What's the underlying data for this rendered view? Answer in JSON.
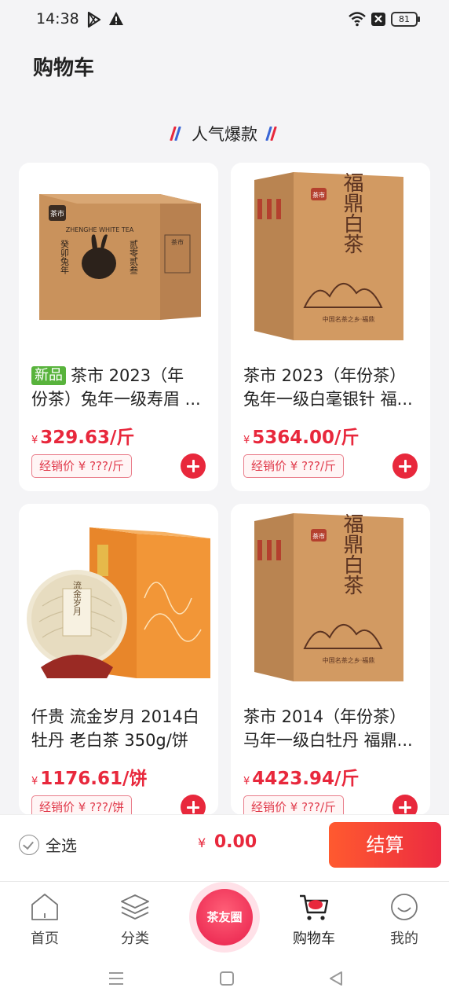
{
  "status_bar": {
    "time": "14:38",
    "battery": "81",
    "icons": [
      "play-store-icon",
      "warning-icon",
      "wifi-icon",
      "sim-card-off-icon",
      "battery-icon"
    ]
  },
  "page": {
    "title": "购物车"
  },
  "section": {
    "title": "人气爆款",
    "icon": "decorative-stripe-icon"
  },
  "products": [
    {
      "badge": "新品",
      "name_line1": "茶市 2023（年",
      "name_line2": "份茶）兔年一级寿眉 ...",
      "price_currency": "¥",
      "price": "329.63/斤",
      "dealer_price": "经销价 ¥ ???/斤",
      "image": "rabbit-year-tea-box-image"
    },
    {
      "badge": "",
      "name_line1": "茶市 2023（年份茶）",
      "name_line2": "兔年一级白毫银针 福...",
      "price_currency": "¥",
      "price": "5364.00/斤",
      "dealer_price": "经销价 ¥ ???/斤",
      "image": "fuding-white-tea-box-image"
    },
    {
      "badge": "",
      "name_line1": "仟贵 流金岁月 2014白",
      "name_line2": "牡丹 老白茶 350g/饼",
      "price_currency": "¥",
      "price": "1176.61/饼",
      "dealer_price": "经销价 ¥ ???/饼",
      "image": "tea-cake-gift-box-image",
      "box_text": "流金岁月"
    },
    {
      "badge": "",
      "name_line1": "茶市 2014（年份茶）",
      "name_line2": "马年一级白牡丹 福鼎...",
      "price_currency": "¥",
      "price": "4423.94/斤",
      "dealer_price": "经销价 ¥ ???/斤",
      "image": "fuding-white-tea-box-image"
    }
  ],
  "box_printing": {
    "brand": "茶市",
    "english": "ZHENGHE WHITE TEA",
    "rabbit_left": "癸卯兔年",
    "rabbit_right": "贰零贰叁",
    "fuding": "福鼎白茶",
    "fuding_sub": "中国名茶之乡·福鼎"
  },
  "checkout": {
    "select_all_label": "全选",
    "total_currency": "¥",
    "total": "0.00",
    "button_label": "结算"
  },
  "tabs": [
    {
      "label": "首页",
      "icon": "home-icon"
    },
    {
      "label": "分类",
      "icon": "layers-icon"
    },
    {
      "label": "茶友圈",
      "icon": "tea-circle-logo"
    },
    {
      "label": "购物车",
      "icon": "cart-icon",
      "active": true
    },
    {
      "label": "我的",
      "icon": "smile-profile-icon"
    }
  ],
  "colors": {
    "accent": "#e8283c",
    "new_badge": "#58b33c",
    "checkout_gradient_start": "#ff5a2f",
    "checkout_gradient_end": "#ec2b41",
    "background": "#f4f4f6"
  }
}
